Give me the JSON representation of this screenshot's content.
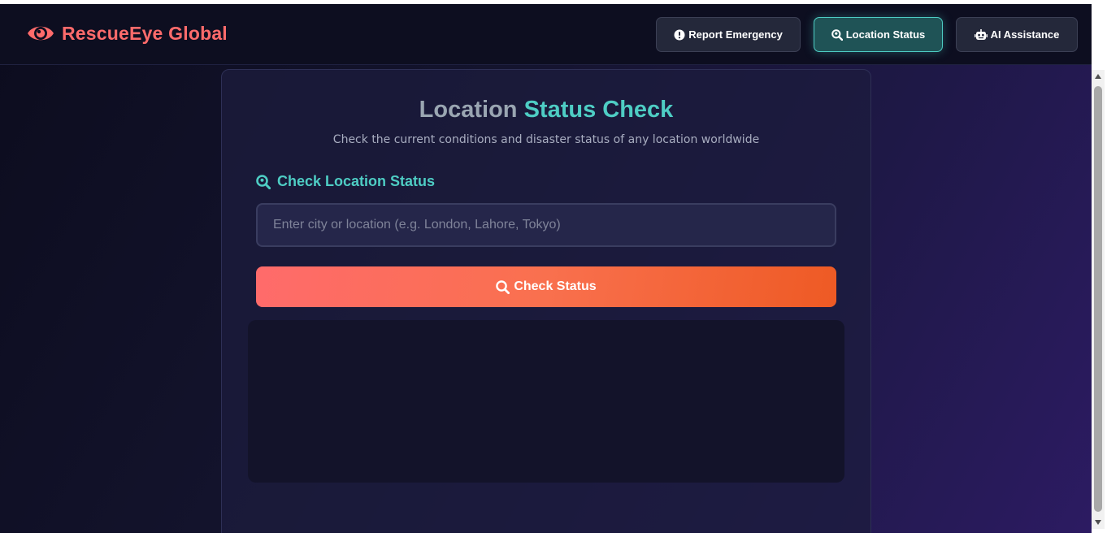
{
  "brand": {
    "name": "RescueEye Global",
    "icon": "eye-icon",
    "color": "#ff6b6b"
  },
  "nav": {
    "report_label": "Report Emergency",
    "report_icon": "exclamation-circle-icon",
    "location_label": "Location Status",
    "location_icon": "search-location-icon",
    "location_active": true,
    "ai_label": "AI Assistance",
    "ai_icon": "robot-icon"
  },
  "page": {
    "title_part1": "Location",
    "title_part2": "Status Check",
    "subtitle": "Check the current conditions and disaster status of any location worldwide",
    "section_label": "Check Location Status",
    "section_icon": "search-location-icon",
    "search_placeholder": "Enter city or location (e.g. London, Lahore, Tokyo)",
    "search_value": "",
    "check_button_label": "Check Status",
    "check_button_icon": "search-icon"
  },
  "colors": {
    "accent": "#4ecdc4",
    "primary": "#ff6b6b",
    "button_gradient_end": "#ee5a24"
  }
}
